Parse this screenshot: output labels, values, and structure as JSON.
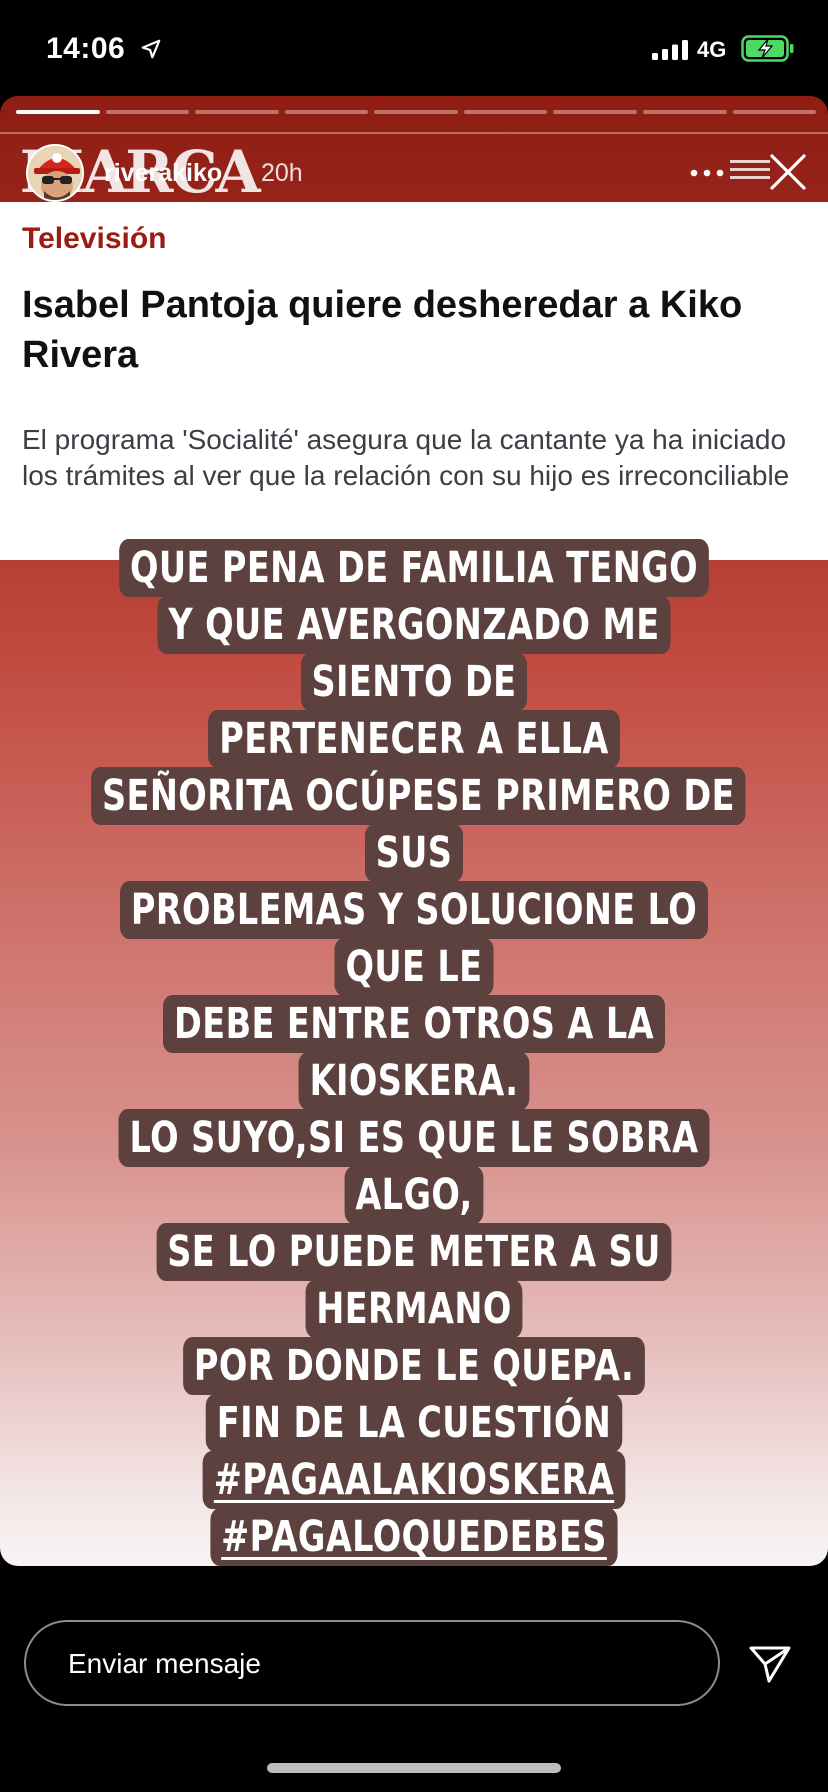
{
  "status_bar": {
    "time": "14:06",
    "network": "4G"
  },
  "story": {
    "progress_segments": 9,
    "progress_current": 1,
    "username": "riverakiko",
    "time_ago": "20h",
    "logo_text": "MARCA"
  },
  "news": {
    "section": "Televisión",
    "title": "Isabel Pantoja quiere desheredar a Kiko Rivera",
    "summary": "El programa 'Socialité' asegura que la cantante ya ha iniciado los trámites al ver que la relación con su hijo es irreconciliable"
  },
  "caption": {
    "lines": [
      "QUE PENA DE FAMILIA TENGO",
      "Y QUE AVERGONZADO ME SIENTO DE",
      "PERTENECER A ELLA",
      "SEÑORITA OCÚPESE PRIMERO DE SUS",
      "PROBLEMAS Y SOLUCIONE LO QUE  LE",
      "DEBE ENTRE OTROS A LA KIOSKERA.",
      "LO SUYO,SI ES QUE LE SOBRA ALGO,",
      "SE LO PUEDE METER A SU HERMANO",
      "POR DONDE LE QUEPA.",
      "FIN DE LA CUESTIÓN"
    ],
    "hashtags": [
      "#PAGAALAKIOSKERA",
      "#PAGALOQUEDEBES"
    ],
    "bg_color": "#5c413e"
  },
  "bottom": {
    "message_placeholder": "Enviar mensaje"
  },
  "icons": {
    "location": "location-arrow-icon",
    "signal": "signal-bars-icon",
    "battery": "battery-charging-icon",
    "more": "more-dots-icon",
    "close": "close-icon",
    "send": "send-icon"
  },
  "colors": {
    "battery": "#4cd964",
    "news_section": "#9c1b12"
  }
}
